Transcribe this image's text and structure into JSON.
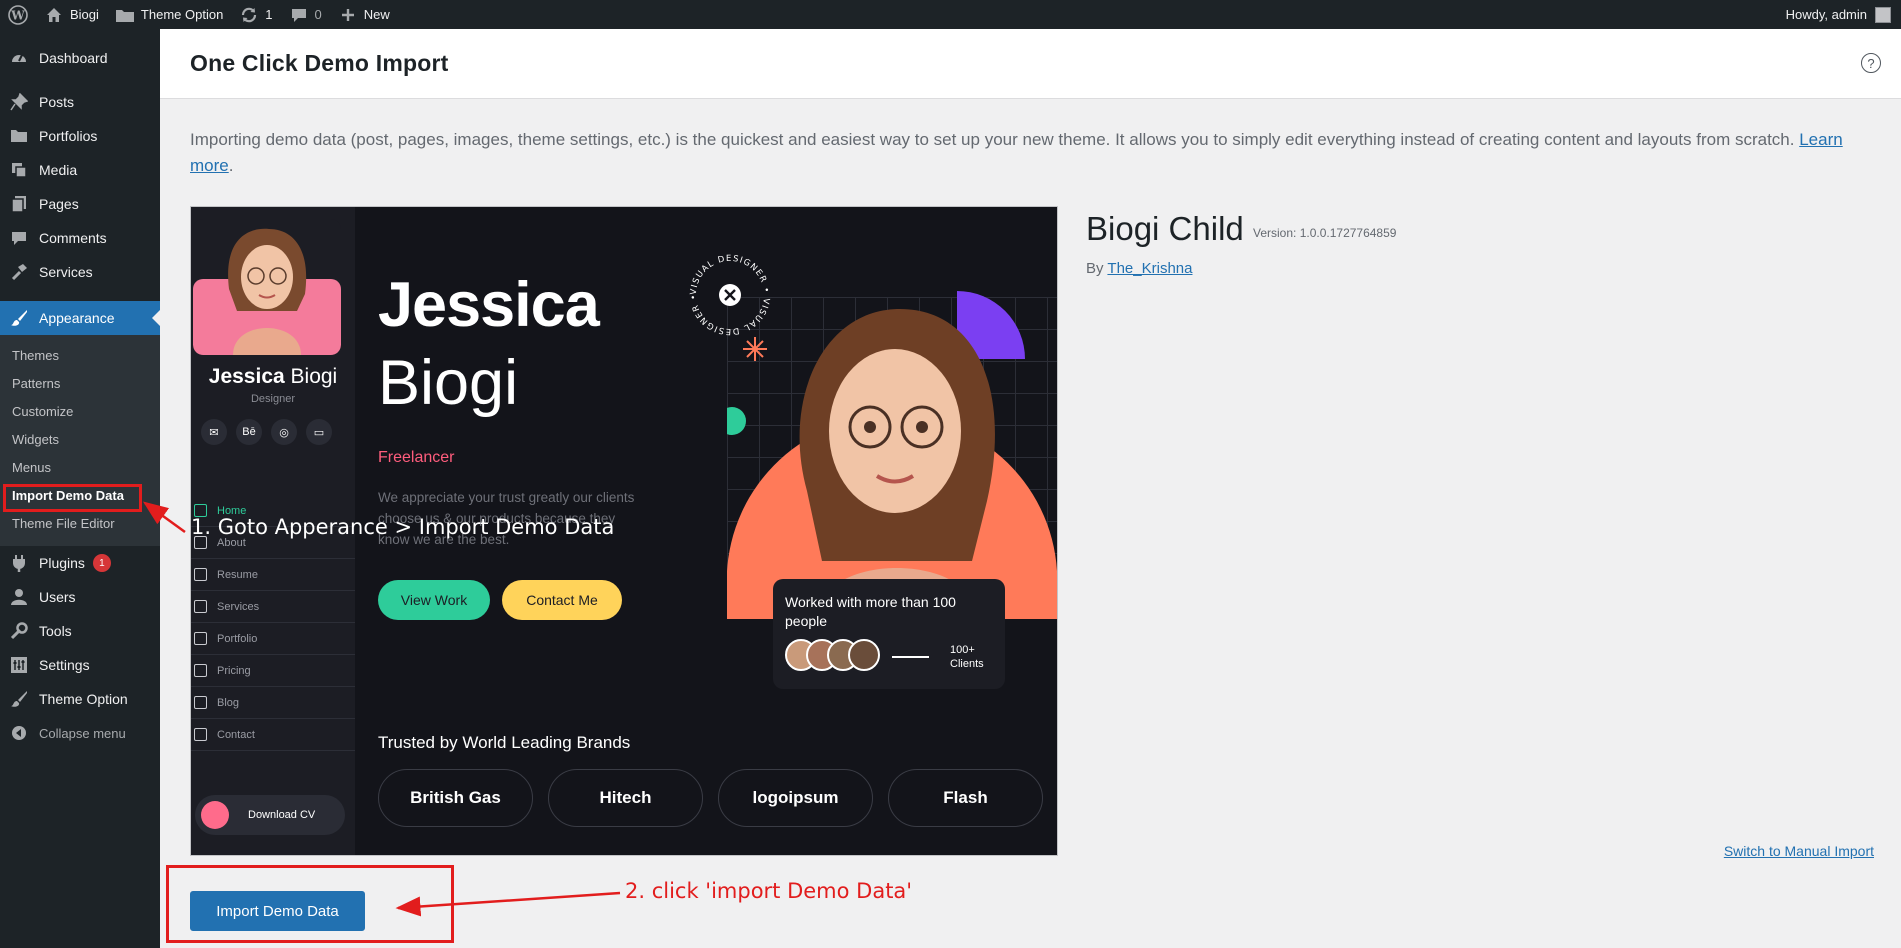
{
  "adminbar": {
    "site_name": "Biogi",
    "theme_option": "Theme Option",
    "updates_count": "1",
    "comments_count": "0",
    "new_label": "New",
    "howdy": "Howdy, admin"
  },
  "sidebar": {
    "items": [
      {
        "label": "Dashboard",
        "icon": "dashboard-icon"
      },
      {
        "label": "Posts",
        "icon": "pin-icon"
      },
      {
        "label": "Portfolios",
        "icon": "folder-icon"
      },
      {
        "label": "Media",
        "icon": "media-icon"
      },
      {
        "label": "Pages",
        "icon": "page-icon"
      },
      {
        "label": "Comments",
        "icon": "comment-icon"
      },
      {
        "label": "Services",
        "icon": "hammer-icon"
      },
      {
        "label": "Appearance",
        "icon": "brush-icon"
      }
    ],
    "submenu": [
      "Themes",
      "Patterns",
      "Customize",
      "Widgets",
      "Menus",
      "Import Demo Data",
      "Theme File Editor"
    ],
    "items_after": [
      {
        "label": "Plugins",
        "icon": "plugin-icon",
        "badge": "1"
      },
      {
        "label": "Users",
        "icon": "user-icon"
      },
      {
        "label": "Tools",
        "icon": "wrench-icon"
      },
      {
        "label": "Settings",
        "icon": "settings-icon"
      },
      {
        "label": "Theme Option",
        "icon": "brush-icon"
      }
    ],
    "collapse": "Collapse menu"
  },
  "main": {
    "title": "One Click Demo Import",
    "intro": "Importing demo data (post, pages, images, theme settings, etc.) is the quickest and easiest way to set up your new theme. It allows you to simply edit everything instead of creating content and layouts from scratch.",
    "learn_more": "Learn more",
    "theme_name": "Biogi Child",
    "theme_version": "Version: 1.0.0.1727764859",
    "by": "By",
    "author": "The_Krishna",
    "manual_link": "Switch to Manual Import",
    "import_button": "Import Demo Data"
  },
  "preview": {
    "first_name": "Jessica",
    "last_name": "Biogi",
    "role": "Designer",
    "social": [
      "✉",
      "Bē",
      "◎",
      "▭"
    ],
    "nav": [
      "Home",
      "About",
      "Resume",
      "Services",
      "Portfolio",
      "Pricing",
      "Blog",
      "Contact"
    ],
    "download_cv": "Download CV",
    "hero_first": "Jessica",
    "hero_last": "Biogi",
    "freelancer": "Freelancer",
    "description": "We appreciate your trust greatly our clients choose us & our products because they know we are the best.",
    "view_work": "View Work",
    "contact_me": "Contact Me",
    "trusted": "Trusted by World Leading Brands",
    "brands": [
      "British Gas",
      "Hitech",
      "logoipsum",
      "Flash"
    ],
    "card_text": "Worked with more than 100 people",
    "clients_count": "100+",
    "clients_label": "Clients",
    "badge_text": "VISUAL DESIGNER • VISUAL DESIGNER •"
  },
  "annotations": {
    "step1": "1. Goto Apperance > Import Demo Data",
    "step2": "2. click 'import Demo Data'"
  },
  "colors": {
    "admin_dark": "#1d2327",
    "wp_blue": "#2271b1",
    "annotation_red": "#e21d1d"
  }
}
